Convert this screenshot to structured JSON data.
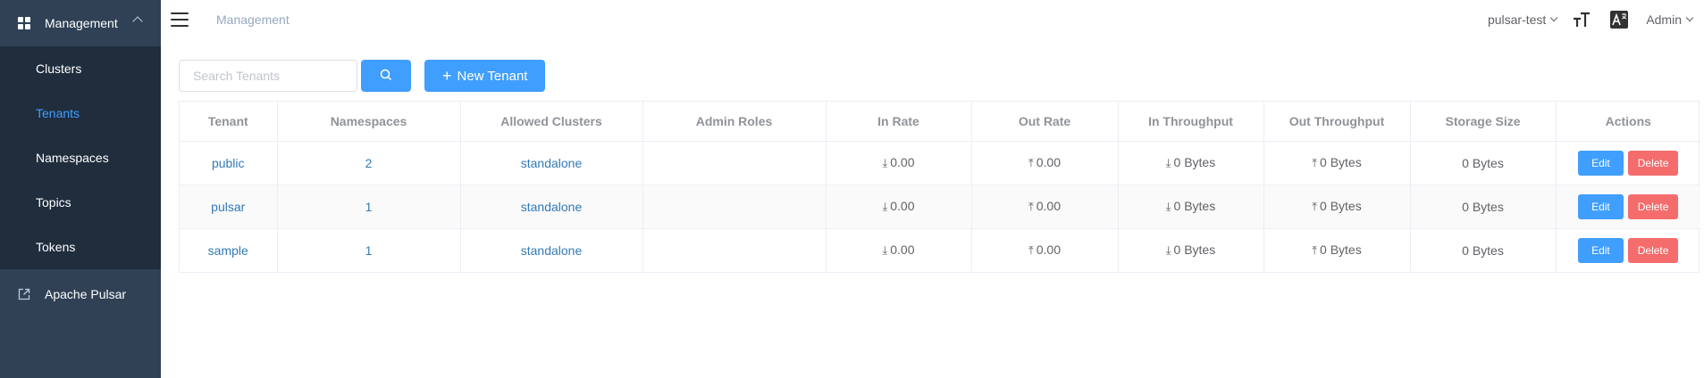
{
  "sidebar": {
    "group_title": "Management",
    "items": [
      {
        "label": "Clusters",
        "active": false
      },
      {
        "label": "Tenants",
        "active": true
      },
      {
        "label": "Namespaces",
        "active": false
      },
      {
        "label": "Topics",
        "active": false
      },
      {
        "label": "Tokens",
        "active": false
      }
    ],
    "external_link": "Apache Pulsar"
  },
  "navbar": {
    "breadcrumb": "Management",
    "cluster": "pulsar-test",
    "user": "Admin"
  },
  "toolbar": {
    "search_placeholder": "Search Tenants",
    "new_button_label": "New Tenant"
  },
  "table": {
    "headers": [
      "Tenant",
      "Namespaces",
      "Allowed Clusters",
      "Admin Roles",
      "In Rate",
      "Out Rate",
      "In Throughput",
      "Out Throughput",
      "Storage Size",
      "Actions"
    ],
    "rows": [
      {
        "tenant": "public",
        "namespaces": "2",
        "clusters": "standalone",
        "roles": "",
        "in_rate": "0.00",
        "out_rate": "0.00",
        "in_throughput": "0 Bytes",
        "out_throughput": "0 Bytes",
        "storage": "0 Bytes"
      },
      {
        "tenant": "pulsar",
        "namespaces": "1",
        "clusters": "standalone",
        "roles": "",
        "in_rate": "0.00",
        "out_rate": "0.00",
        "in_throughput": "0 Bytes",
        "out_throughput": "0 Bytes",
        "storage": "0 Bytes"
      },
      {
        "tenant": "sample",
        "namespaces": "1",
        "clusters": "standalone",
        "roles": "",
        "in_rate": "0.00",
        "out_rate": "0.00",
        "in_throughput": "0 Bytes",
        "out_throughput": "0 Bytes",
        "storage": "0 Bytes"
      }
    ],
    "edit_label": "Edit",
    "delete_label": "Delete"
  },
  "colors": {
    "sidebar_bg": "#304156",
    "submenu_bg": "#1f2d3d",
    "primary": "#409eff",
    "danger": "#f56c6c",
    "link": "#337ab7"
  }
}
